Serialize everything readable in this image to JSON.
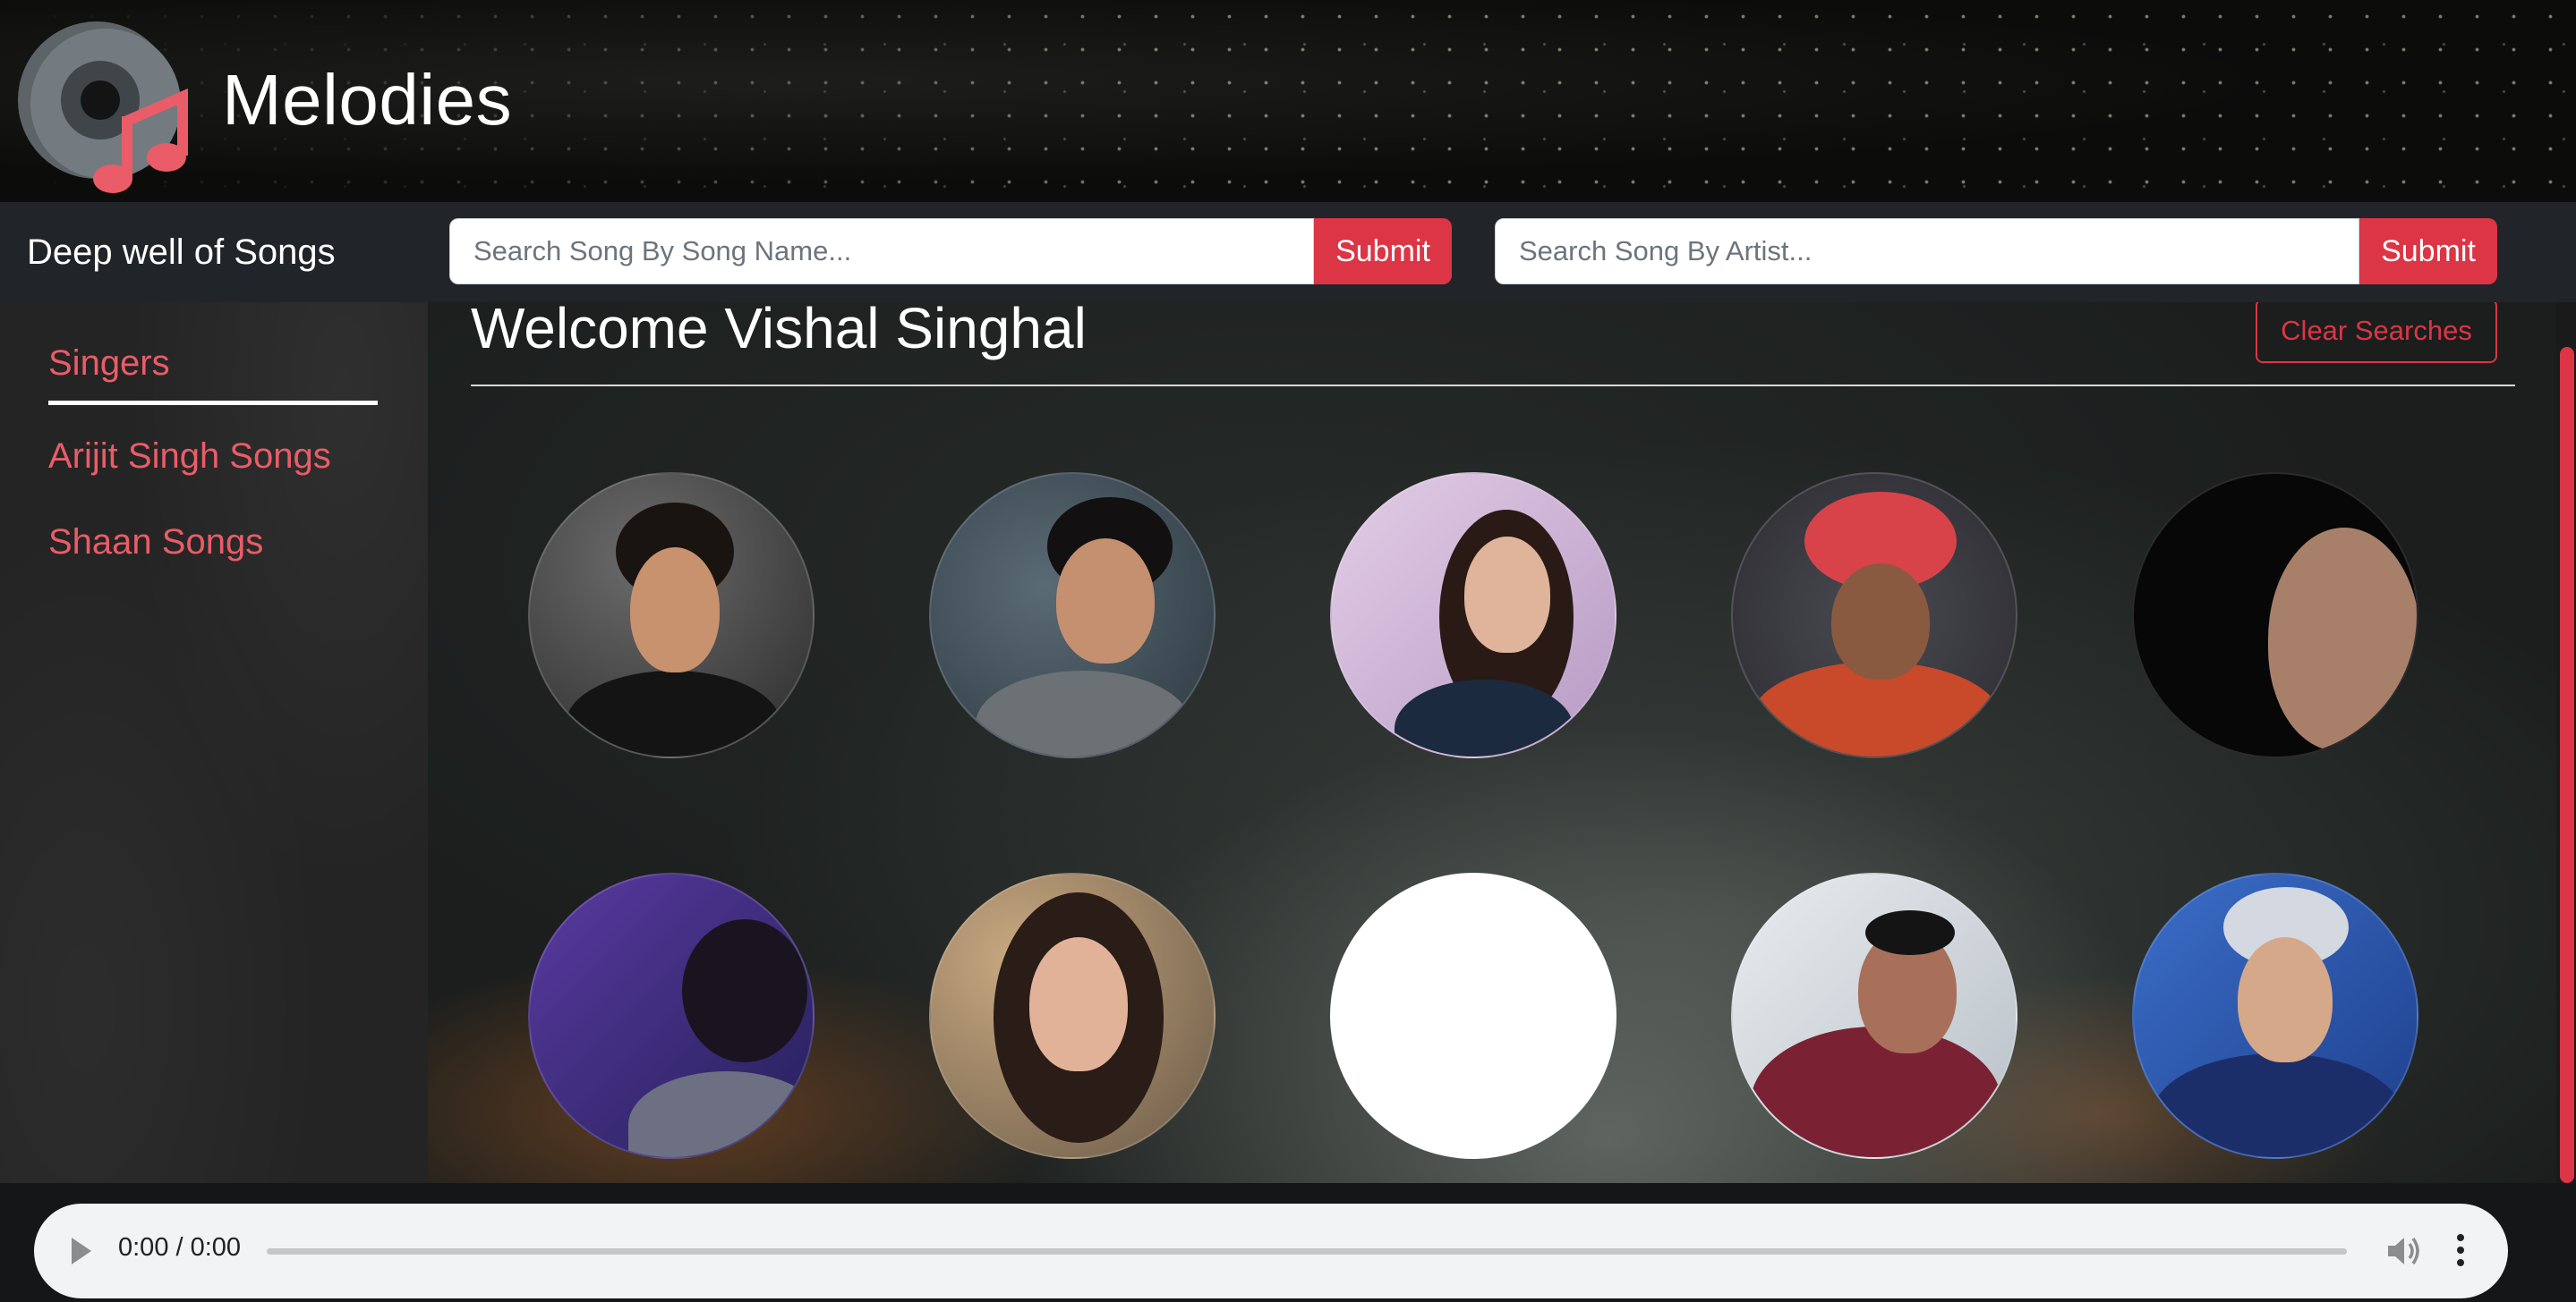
{
  "header": {
    "app_title": "Melodies",
    "logo_icon": "music-disc-logo",
    "accent_color": "#dc3545"
  },
  "navbar": {
    "brand": "Deep well of Songs",
    "song_search": {
      "placeholder": "Search Song By Song Name...",
      "value": "",
      "submit_label": "Submit"
    },
    "artist_search": {
      "placeholder": "Search Song By Artist...",
      "value": "",
      "submit_label": "Submit"
    }
  },
  "sidebar": {
    "items": [
      {
        "label": "Singers",
        "active": true
      },
      {
        "label": "Arijit Singh Songs",
        "active": false
      },
      {
        "label": "Shaan Songs",
        "active": false
      }
    ]
  },
  "main": {
    "welcome": "Welcome Vishal Singhal",
    "clear_label": "Clear Searches",
    "singers_grid_rows": 2,
    "singers_grid_cols": 5
  },
  "player": {
    "time": "0:00 / 0:00",
    "progress": 0,
    "play_icon": "play-icon",
    "volume_icon": "volume-icon",
    "more_icon": "more-options-icon"
  }
}
